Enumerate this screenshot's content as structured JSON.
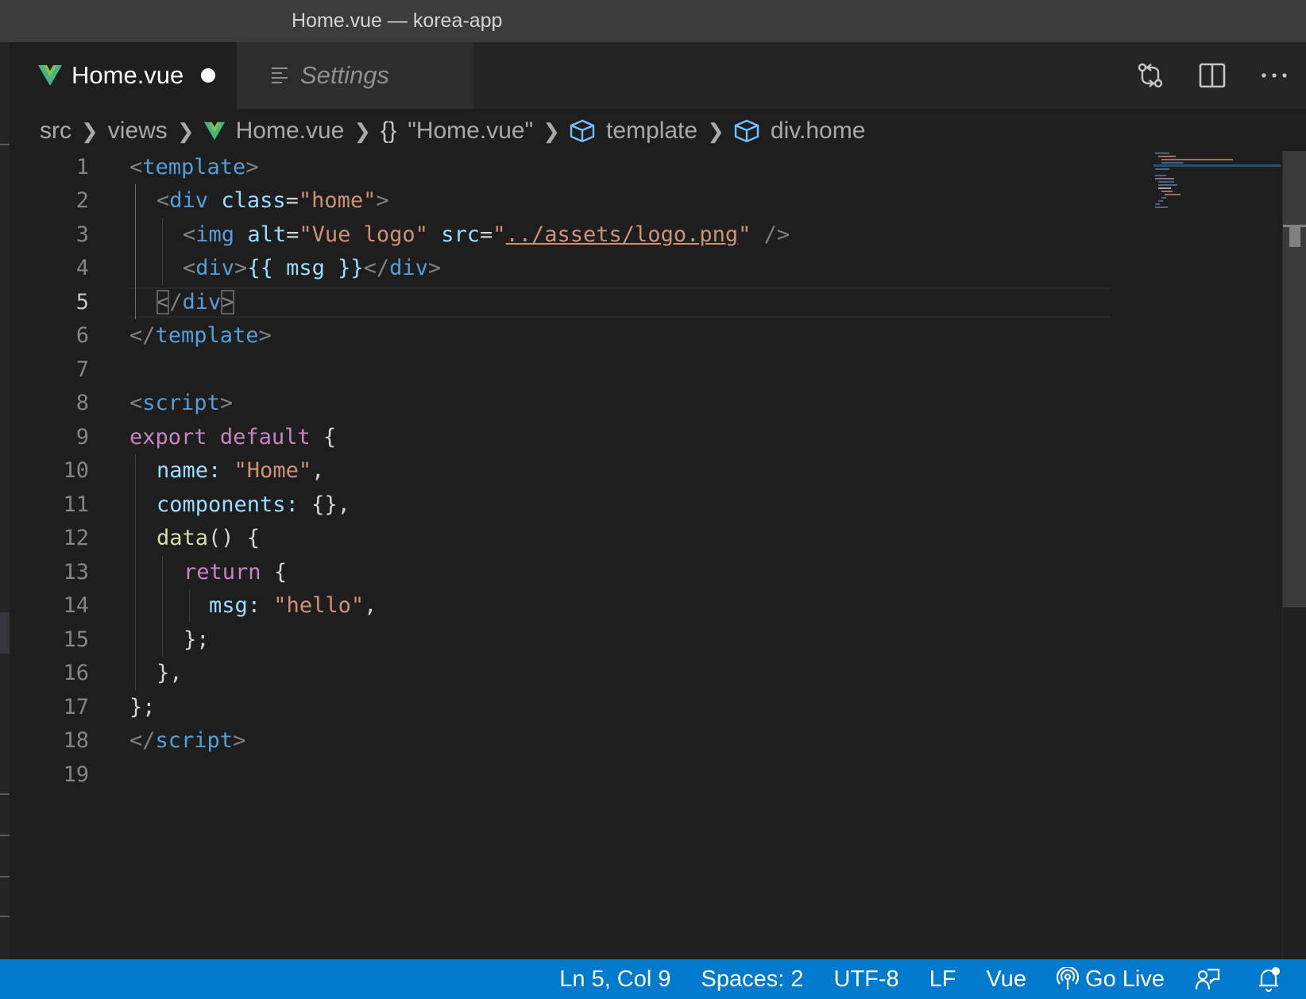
{
  "window": {
    "title": "Home.vue — korea-app"
  },
  "tabs": [
    {
      "label": "Home.vue",
      "icon": "vue-icon",
      "active": true,
      "dirty": true
    },
    {
      "label": "Settings",
      "icon": "settings-icon",
      "active": false
    }
  ],
  "tab_actions": [
    "open-changes-icon",
    "split-editor-icon",
    "more-actions-icon"
  ],
  "breadcrumb": {
    "items": [
      "src",
      "views",
      "Home.vue",
      "\"Home.vue\"",
      "template",
      "div.home"
    ],
    "braces": "{}"
  },
  "editor": {
    "current_line": 5,
    "line_numbers": [
      "1",
      "2",
      "3",
      "4",
      "5",
      "6",
      "7",
      "8",
      "9",
      "10",
      "11",
      "12",
      "13",
      "14",
      "15",
      "16",
      "17",
      "18",
      "19"
    ]
  },
  "code": {
    "l1": {
      "open": "<",
      "tag": "template",
      "close": ">"
    },
    "l2": {
      "open": "<",
      "tag": "div",
      "attr": "class",
      "eq": "=",
      "val": "\"home\"",
      "close": ">"
    },
    "l3": {
      "open": "<",
      "tag": "img",
      "attr1": "alt",
      "eq": "=",
      "val1": "\"Vue logo\"",
      "attr2": "src",
      "q1": "\"",
      "link": "../assets/logo.png",
      "q2": "\"",
      "end": " />"
    },
    "l4": {
      "open": "<",
      "tag": "div",
      "close": ">",
      "expr": "{{ msg }}",
      "open2": "</",
      "tag2": "div",
      "close2": ">"
    },
    "l5": {
      "lt": "<",
      "slash": "/",
      "tag": "div",
      "gt": ">"
    },
    "l6": {
      "open": "</",
      "tag": "template",
      "close": ">"
    },
    "l8": {
      "open": "<",
      "tag": "script",
      "close": ">"
    },
    "l9": {
      "kw1": "export",
      "kw2": "default",
      "brace": "{"
    },
    "l10": {
      "prop": "name:",
      "val": "\"Home\"",
      "end": ","
    },
    "l11": {
      "prop": "components:",
      "end": "{},"
    },
    "l12": {
      "fn": "data",
      "end": "() {"
    },
    "l13": {
      "kw": "return",
      "end": "{"
    },
    "l14": {
      "prop": "msg:",
      "val": "\"hello\"",
      "end": ","
    },
    "l15": {
      "text": "};"
    },
    "l16": {
      "text": "},"
    },
    "l17": {
      "text": "};"
    },
    "l18": {
      "open": "</",
      "tag": "script",
      "close": ">"
    }
  },
  "statusbar": {
    "position": "Ln 5, Col 9",
    "spaces": "Spaces: 2",
    "encoding": "UTF-8",
    "eol": "LF",
    "language": "Vue",
    "golive": "Go Live",
    "feedback_icon": "feedback-icon",
    "notifications_icon": "bell-icon",
    "background": "#007acc"
  }
}
